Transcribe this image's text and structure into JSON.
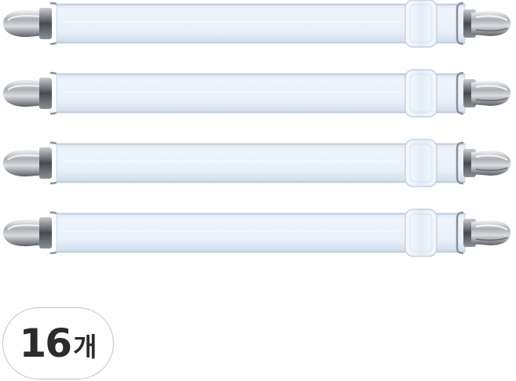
{
  "product": {
    "item_icon": "elastic-sheet-strap-with-clips",
    "strap_count_in_photo": 4,
    "colors": {
      "strap": "#e7f0fa",
      "strap_edge": "#c7d6e6",
      "buckle": "#f3f7fc",
      "metal": "#9aa0a6"
    }
  },
  "badge": {
    "number": "16",
    "unit": "개"
  }
}
